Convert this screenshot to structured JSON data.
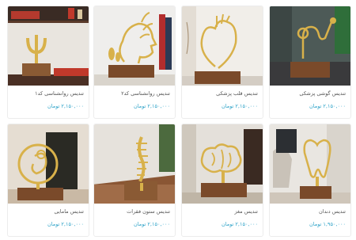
{
  "products": [
    {
      "title": "تندیس روانشناسی کد۱",
      "price": "۲,۱۵۰,۰۰۰ تومان",
      "icon": "psi-statue-icon"
    },
    {
      "title": "تندیس روانشناسی کد۲",
      "price": "۲,۱۵۰,۰۰۰ تومان",
      "icon": "head-leaves-statue-icon"
    },
    {
      "title": "تندیس قلب پزشکی",
      "price": "۲,۱۵۰,۰۰۰ تومان",
      "icon": "heart-statue-icon"
    },
    {
      "title": "تندیس گوشی پزشکی",
      "price": "۲,۱۵۰,۰۰۰ تومان",
      "icon": "stethoscope-statue-icon"
    },
    {
      "title": "تندیس مامایی",
      "price": "۲,۱۵۰,۰۰۰ تومان",
      "icon": "fetus-statue-icon"
    },
    {
      "title": "تندیس ستون فقرات",
      "price": "۲,۱۵۰,۰۰۰ تومان",
      "icon": "spine-statue-icon"
    },
    {
      "title": "تندیس مغز",
      "price": "۲,۱۵۰,۰۰۰ تومان",
      "icon": "brain-statue-icon"
    },
    {
      "title": "تندیس دندان",
      "price": "۱,۹۵۰,۰۰۰ تومان",
      "icon": "tooth-statue-icon"
    }
  ],
  "colors": {
    "price": "#2ea3c8",
    "gold": "#d8b14a",
    "wood": "#7a4a2a"
  }
}
